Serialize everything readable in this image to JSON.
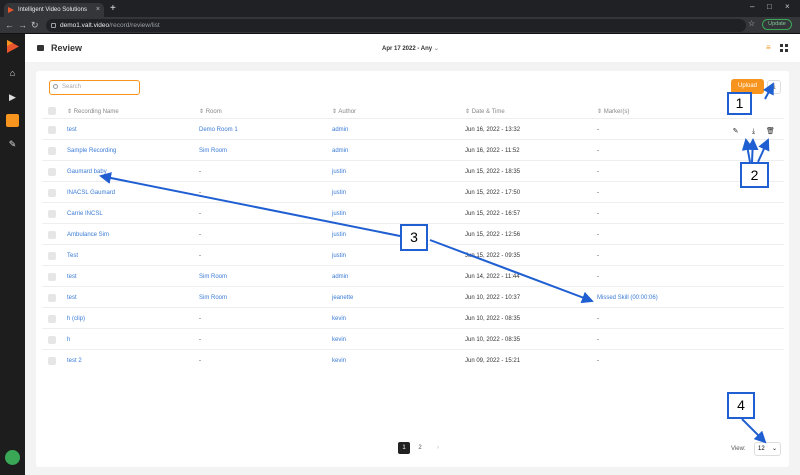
{
  "browser": {
    "tab_title": "Intelligent Video Solutions",
    "tab_close": "×",
    "new_tab": "+",
    "url_domain": "demo1.valt.video",
    "url_path": "/record/review/list",
    "update_label": "Update",
    "window_controls": [
      "–",
      "□",
      "×"
    ]
  },
  "app": {
    "page_title": "Review",
    "date_filter": "Apr 17 2022 - Any",
    "search_placeholder": "Search",
    "upload_label": "Upload",
    "columns": [
      "Recording Name",
      "Room",
      "Author",
      "Date & Time",
      "Marker(s)"
    ],
    "rows": [
      {
        "name": "test",
        "room": "Demo Room 1",
        "author": "admin",
        "datetime": "Jun 16, 2022 - 13:32",
        "markers": "-"
      },
      {
        "name": "Sample Recording",
        "room": "Sim Room",
        "author": "admin",
        "datetime": "Jun 16, 2022 - 11:52",
        "markers": "-"
      },
      {
        "name": "Gaumard baby",
        "room": "-",
        "author": "justin",
        "datetime": "Jun 15, 2022 - 18:35",
        "markers": "-"
      },
      {
        "name": "INACSL Gaumard",
        "room": "-",
        "author": "justin",
        "datetime": "Jun 15, 2022 - 17:50",
        "markers": "-"
      },
      {
        "name": "Carrie INCSL",
        "room": "-",
        "author": "justin",
        "datetime": "Jun 15, 2022 - 16:57",
        "markers": "-"
      },
      {
        "name": "Ambulance Sim",
        "room": "-",
        "author": "justin",
        "datetime": "Jun 15, 2022 - 12:56",
        "markers": "-"
      },
      {
        "name": "Test",
        "room": "-",
        "author": "justin",
        "datetime": "Jun 15, 2022 - 09:35",
        "markers": "-"
      },
      {
        "name": "test",
        "room": "Sim Room",
        "author": "admin",
        "datetime": "Jun 14, 2022 - 11:44",
        "markers": "-"
      },
      {
        "name": "test",
        "room": "Sim Room",
        "author": "jeanette",
        "datetime": "Jun 10, 2022 - 10:37",
        "markers": "Missed Skill (00:00:06)"
      },
      {
        "name": "h (clip)",
        "room": "-",
        "author": "kevin",
        "datetime": "Jun 10, 2022 - 08:35",
        "markers": "-"
      },
      {
        "name": "h",
        "room": "-",
        "author": "kevin",
        "datetime": "Jun 10, 2022 - 08:35",
        "markers": "-"
      },
      {
        "name": "test 2",
        "room": "-",
        "author": "kevin",
        "datetime": "Jun 09, 2022 - 15:21",
        "markers": "-"
      }
    ],
    "pagination": {
      "pages": [
        "1",
        "2"
      ],
      "current": "1",
      "next": "›"
    },
    "view_label": "View:",
    "view_value": "12"
  },
  "callouts": [
    "1",
    "2",
    "3",
    "4"
  ],
  "colors": {
    "accent": "#f7941d",
    "link": "#3a7bd5",
    "callout": "#1f5fd1"
  }
}
